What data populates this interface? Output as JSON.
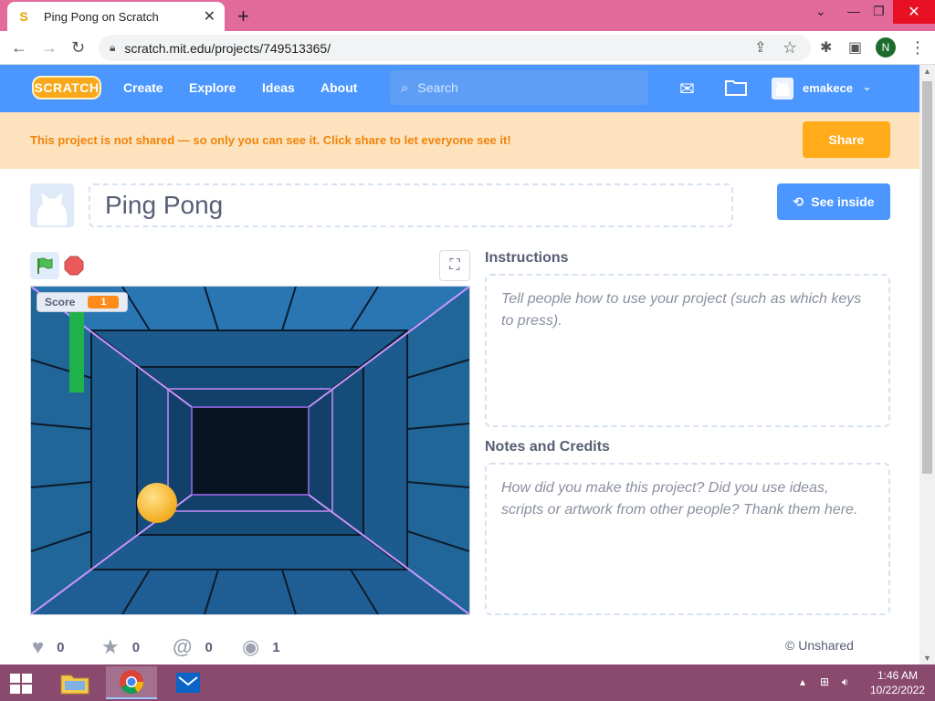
{
  "browser": {
    "tab_title": "Ping Pong on Scratch",
    "tab_favicon": "S",
    "new_tab": "+",
    "url": "scratch.mit.edu/projects/749513365/",
    "profile_initial": "N"
  },
  "nav": {
    "logo": "SCRATCH",
    "links": [
      "Create",
      "Explore",
      "Ideas",
      "About"
    ],
    "search_placeholder": "Search",
    "username": "emakece"
  },
  "banner": {
    "text": "This project is not shared — so only you can see it. Click share to let everyone see it!",
    "share_label": "Share"
  },
  "project": {
    "title": "Ping Pong",
    "see_inside_label": "See inside"
  },
  "stage": {
    "score_label": "Score",
    "score_value": "1"
  },
  "instructions": {
    "heading": "Instructions",
    "placeholder": "Tell people how to use your project (such as which keys to press)."
  },
  "notes": {
    "heading": "Notes and Credits",
    "placeholder": "How did you make this project? Did you use ideas, scripts or artwork from other people? Thank them here."
  },
  "stats": {
    "loves": "0",
    "favorites": "0",
    "remixes": "0",
    "views": "1",
    "share_status": "© Unshared"
  },
  "taskbar": {
    "time": "1:46 AM",
    "date": "10/22/2022"
  },
  "colors": {
    "scratch_blue": "#4c97ff",
    "share_orange": "#ffab1a",
    "banner_bg": "#fde3bd",
    "banner_text": "#f2830a",
    "tab_strip": "#e36b9c"
  }
}
